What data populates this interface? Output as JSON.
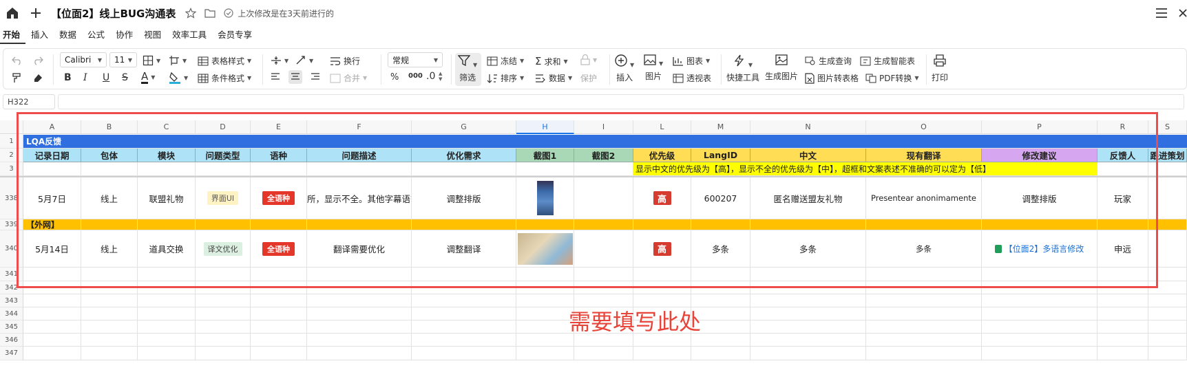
{
  "title_bar": {
    "doc_title": "【位面2】线上BUG沟通表",
    "last_modified": "上次修改是在3天前进行的"
  },
  "menu_tabs": [
    "开始",
    "插入",
    "数据",
    "公式",
    "协作",
    "视图",
    "效率工具",
    "会员专享"
  ],
  "toolbar": {
    "font_name": "Calibri",
    "font_size": "11",
    "table_style": "表格样式",
    "cond_format": "条件格式",
    "wrap": "换行",
    "merge": "合并",
    "number_format": "常规",
    "percent": "%",
    "thousands": "000",
    "decimal": ".0",
    "filter": "筛选",
    "freeze": "冻结",
    "sort": "排序",
    "sum": "求和",
    "data": "数据",
    "protect": "保护",
    "insert": "插入",
    "picture": "图片",
    "chart": "图表",
    "pivot": "透视表",
    "quick_tools": "快捷工具",
    "gen_image": "生成图片",
    "gen_query": "生成查询",
    "img_to_table": "图片转表格",
    "gen_smart_table": "生成智能表",
    "pdf_convert": "PDF转换",
    "print": "打印"
  },
  "name_box": "H322",
  "columns": [
    "A",
    "B",
    "C",
    "D",
    "E",
    "F",
    "G",
    "H",
    "I",
    "L",
    "M",
    "N",
    "O",
    "P",
    "R",
    "S"
  ],
  "row_numbers": [
    "1",
    "2",
    "3",
    "338",
    "339",
    "340",
    "341",
    "342",
    "343",
    "344",
    "345",
    "346",
    "347"
  ],
  "row1_title": "LQA反馈",
  "headers": [
    "记录日期",
    "包体",
    "模块",
    "问题类型",
    "语种",
    "问题描述",
    "优化需求",
    "截图1",
    "截图2",
    "优先级",
    "LangID",
    "中文",
    "现有翻译",
    "修改建议",
    "反馈人",
    "跟进策划"
  ],
  "row3_note": "显示中文的优先级为【高】，显示不全的优先级为【中】，超框和文案表述不准确的可以定为【低】",
  "row338": {
    "date": "5月7日",
    "package": "线上",
    "module": "联盟礼物",
    "type": "界面UI",
    "lang": "全语种",
    "desc": "所，显示不全。其他字幕语言",
    "need": "调整排版",
    "priority": "高",
    "langid": "600207",
    "zh": "匿名赠送盟友礼物",
    "trans": "Presentear anonimamente",
    "suggest": "调整排版",
    "reporter": "玩家"
  },
  "row339_label": "【外网】",
  "row340": {
    "date": "5月14日",
    "package": "线上",
    "module": "道具交换",
    "type": "译文优化",
    "lang": "全语种",
    "desc": "翻译需要优化",
    "need": "调整翻译",
    "priority": "高",
    "langid": "多条",
    "zh": "多条",
    "trans": "多条",
    "suggest": "【位面2】多语言修改",
    "reporter": "申远"
  },
  "annotation": "需要填写此处",
  "colors": {
    "title_row": "#2f6fe0",
    "header_cyan": "#aee2f7",
    "header_green": "#a8d8b6",
    "header_yellow": "#ffdd55",
    "header_purple": "#d6a7f0",
    "outer_row": "#ffc000",
    "note_yellow": "#ffff00",
    "highlight": "#ef4b4b"
  }
}
